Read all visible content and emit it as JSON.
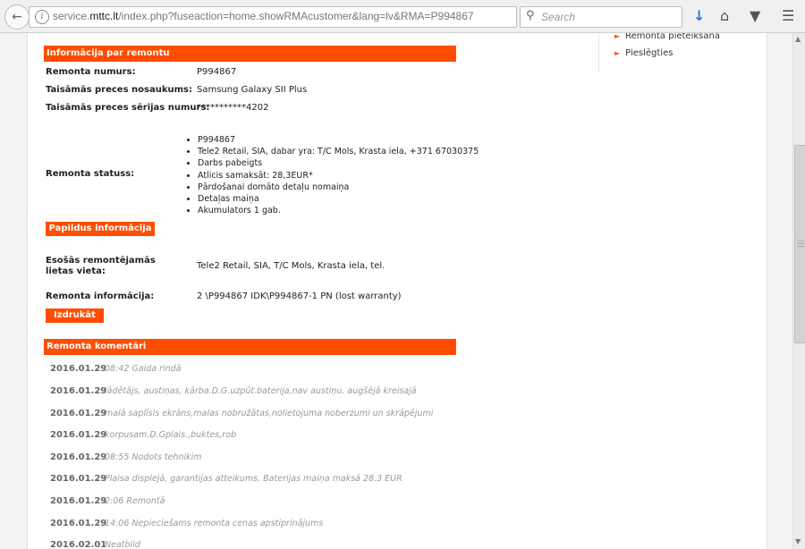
{
  "browser": {
    "url_prefix": "service.",
    "url_domain": "mttc.lt",
    "url_path": "/index.php?fuseaction=home.showRMAcustomer&lang=lv&RMA=P994867",
    "search_placeholder": "Search"
  },
  "info": {
    "header": "Informācija par remontu",
    "fields": [
      {
        "label": "Remonta numurs:",
        "value": "P994867"
      },
      {
        "label": "Taisāmās preces nosaukums:",
        "value": "Samsung Galaxy SII Plus"
      },
      {
        "label": "Taisāmās preces sērijas numurs:",
        "value": "***********4202"
      }
    ],
    "status_label": "Remonta statuss:",
    "status_items": [
      "P994867",
      "Tele2 Retail, SIA, dabar yra: T/C Mols, Krasta iela, +371 67030375",
      "Darbs pabeigts",
      "Atlicis samaksāt: 28,3EUR*",
      "Pārdošanai domāto detaļu nomaiņa",
      "Detaļas maiņa",
      "Akumulators 1 gab."
    ],
    "more_info_button": "Papildus informācija",
    "location_label": "Esošās remontējamās lietas vieta:",
    "location_value": "Tele2 Retail, SIA, T/C Mols, Krasta iela, tel.",
    "repair_info_label": "Remonta informācija:",
    "repair_info_value": "2 \\P994867 IDK\\P994867-1 PN (lost warranty)",
    "print_button": "Izdrukāt"
  },
  "comments": {
    "header": "Remonta komentāri",
    "items": [
      {
        "date": "2016.01.29",
        "text": "08:42 Gaida rindā"
      },
      {
        "date": "2016.01.29",
        "text": "lādētājs, austiņas, kārba.D.G.uzpūt.baterija,nav austiņu. augšējā kreisajā"
      },
      {
        "date": "2016.01.29",
        "text": "malā saplīsis ekrāns,malas nobružātas,nolietojuma noberzumi un skrāpējumi"
      },
      {
        "date": "2016.01.29",
        "text": "korpusam.D.Gplais.,buktes,rob"
      },
      {
        "date": "2016.01.29",
        "text": "08:55 Nodots tehnikim"
      },
      {
        "date": "2016.01.29",
        "text": "Plaisa displejā, garantijas atteikums. Baterijas maiņa maksā 28.3 EUR"
      },
      {
        "date": "2016.01.29",
        "text": "2:06 Remontā"
      },
      {
        "date": "2016.01.29",
        "text": "14:06 Nepieciešams remonta cenas apstiprinājums"
      },
      {
        "date": "2016.02.01",
        "text": "Neatbild"
      }
    ]
  },
  "sidebar": {
    "links": [
      "Remonta pieteikšana",
      "Pieslēgties"
    ]
  },
  "colors": {
    "accent": "#ff4d00"
  }
}
